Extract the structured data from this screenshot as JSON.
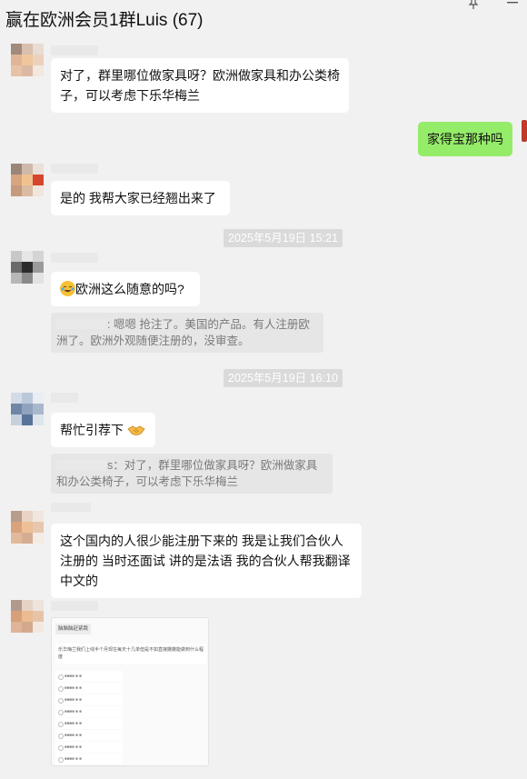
{
  "chat": {
    "title": "赢在欧洲会员1群Luis (67)"
  },
  "messages": {
    "m1": "对了，群里哪位做家具呀？欧洲做家具和办公类椅子，可以考虑下乐华梅兰",
    "m2": "家得宝那种吗",
    "m3": "是的  我帮大家已经翘出来了",
    "ts1": "2025年5月19日 15:21",
    "m4": "欧洲这么随意的吗?",
    "q1": ": 嗯嗯 抢注了。美国的产品。有人注册欧洲了。欧洲外观随便注册的，没审查。",
    "ts2": "2025年5月19日 16:10",
    "m5": "帮忙引荐下",
    "q2": "s：对了，群里哪位做家具呀？欧洲做家具和办公类椅子，可以考虑下乐华梅兰",
    "m6": "这个国内的人很少能注册下来的  我是让我们合伙人注册的  当时还面试  讲的是法语   我的合伙人帮我翻译中文的"
  },
  "image_card": {
    "header": "脑脑脑赶紧跳",
    "message": "乐华梅兰我们上线半个月现在每天十几单但是不如直接撒撒能做到什么程度",
    "rows": [
      "■■■■ ■ ■",
      "■■■■ ■ ■",
      "■■■■ ■ ■",
      "■■■■ ■ ■",
      "■■■■ ■ ■",
      "■■■■ ■ ■",
      "■■■■ ■ ■",
      "■■■■ ■ ■"
    ]
  },
  "colors": {
    "background": "#f1f1f1",
    "bubble_incoming": "#ffffff",
    "bubble_outgoing": "#95ec69",
    "timestamp_bg": "#dadada",
    "quote_bg": "#e6e6e6"
  },
  "icons": [
    "pin-icon",
    "more-icon",
    "crying-laughing-emoji-icon",
    "handshake-emoji-icon"
  ]
}
